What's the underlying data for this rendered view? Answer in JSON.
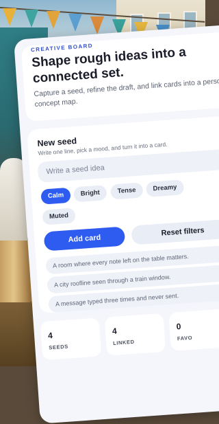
{
  "hero": {
    "eyebrow": "CREATIVE BOARD",
    "title": "Shape rough ideas into a connected set.",
    "subtitle": "Capture a seed, refine the draft, and link cards into a personal concept map."
  },
  "new_seed": {
    "title": "New seed",
    "helper": "Write one line, pick a mood, and turn it into a card.",
    "input_placeholder": "Write a seed idea",
    "input_value": "",
    "moods": [
      {
        "label": "Calm",
        "active": true
      },
      {
        "label": "Bright",
        "active": false
      },
      {
        "label": "Tense",
        "active": false
      },
      {
        "label": "Dreamy",
        "active": false
      },
      {
        "label": "Muted",
        "active": false
      }
    ],
    "add_label": "Add card",
    "reset_label": "Reset filters",
    "samples": [
      "A room where every note left on the table matters.",
      "A city roofline seen through a train window.",
      "A message typed three times and never sent."
    ]
  },
  "stats": [
    {
      "value": "4",
      "label": "SEEDS"
    },
    {
      "value": "4",
      "label": "LINKED"
    },
    {
      "value": "0",
      "label": "FAVO"
    }
  ],
  "colors": {
    "accent": "#2f5cf0",
    "sheet": "#f4f6fb",
    "card": "#ffffff",
    "chip": "#e9edf6"
  }
}
